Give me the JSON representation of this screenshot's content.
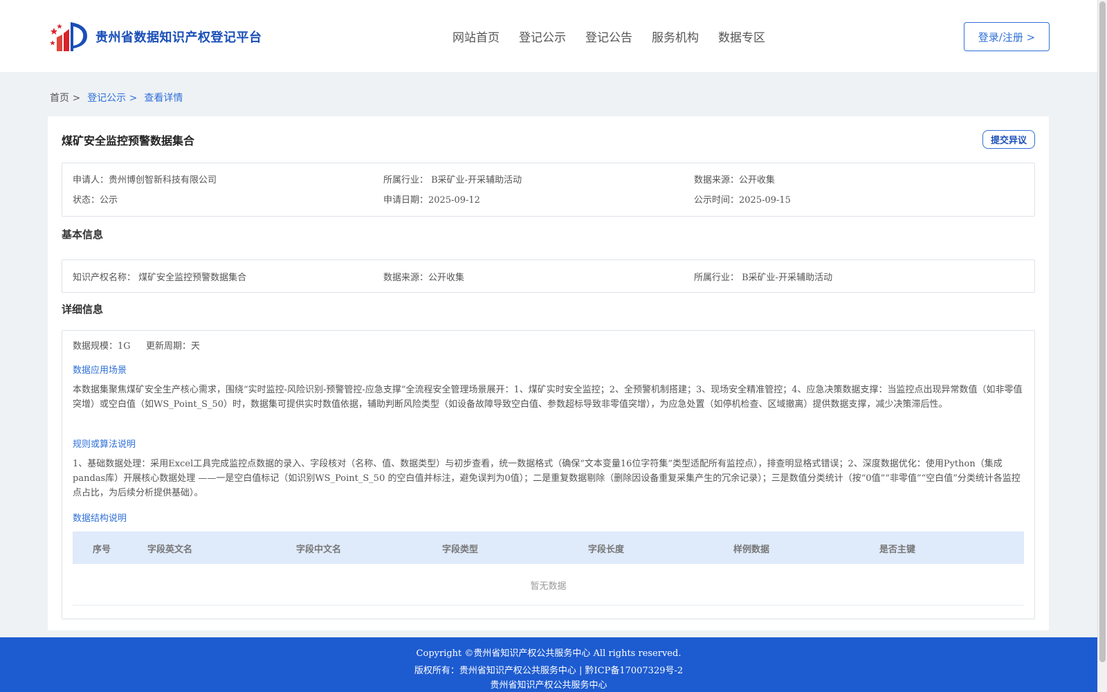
{
  "header": {
    "logo_text": "贵州省数据知识产权登记平台",
    "nav": [
      "网站首页",
      "登记公示",
      "登记公告",
      "服务机构",
      "数据专区"
    ],
    "login_label": "登录/注册 >"
  },
  "breadcrumb": {
    "home": "首页 >",
    "section": "登记公示 >",
    "current": "查看详情"
  },
  "record": {
    "title": "煤矿安全监控预警数据集合",
    "objection_label": "提交异议",
    "applicant": "申请人：贵州博创智新科技有限公司",
    "industry": "所属行业： B采矿业-开采辅助活动",
    "source": "数据来源：公开收集",
    "status": "状态：公示",
    "apply_date": "申请日期：2025-09-12",
    "publish_date": "公示时间：2025-09-15"
  },
  "basic": {
    "section_title": "基本信息",
    "ip_name": "知识产权名称： 煤矿安全监控预警数据集合",
    "source": "数据来源：公开收集",
    "industry": "所属行业： B采矿业-开采辅助活动"
  },
  "detail": {
    "section_title": "详细信息",
    "scale": "数据规模：1G",
    "cycle": "更新周期：天",
    "scenario_title": "数据应用场景",
    "scenario_text": "本数据集聚焦煤矿安全生产核心需求，围绕“实时监控-风险识别-预警管控-应急支撑”全流程安全管理场景展开：1、煤矿实时安全监控；2、全预警机制搭建；3、现场安全精准管控；4、应急决策数据支撑：当监控点出现异常数值（如非零值突增）或空白值（如WS_Point_S_50）时，数据集可提供实时数值依据，辅助判断风险类型（如设备故障导致空白值、参数超标导致非零值突增），为应急处置（如停机检查、区域撤离）提供数据支撑，减少决策滞后性。",
    "rules_title": "规则或算法说明",
    "rules_text": "1、基础数据处理：采用Excel工具完成监控点数据的录入、字段核对（名称、值、数据类型）与初步查看，统一数据格式（确保“文本变量16位字符集”类型适配所有监控点），排查明显格式错误；2、深度数据优化：使用Python（集成pandas库）开展核心数据处理 ——一是空白值标记（如识别WS_Point_S_50 的空白值并标注，避免误判为0值）；二是重复数据剔除（删除因设备重复采集产生的冗余记录）；三是数值分类统计（按“0值”“非零值”“空白值”分类统计各监控点占比，为后续分析提供基础）。",
    "structure_title": "数据结构说明",
    "table_headers": [
      "序号",
      "字段英文名",
      "字段中文名",
      "字段类型",
      "字段长度",
      "样例数据",
      "是否主键"
    ],
    "empty_text": "暂无数据"
  },
  "footer": {
    "copyright": "Copyright ©贵州省知识产权公共服务中心 All rights reserved.",
    "rights": "版权所有：贵州省知识产权公共服务中心 | 黔ICP备17007329号-2",
    "org": "贵州省知识产权公共服务中心"
  }
}
